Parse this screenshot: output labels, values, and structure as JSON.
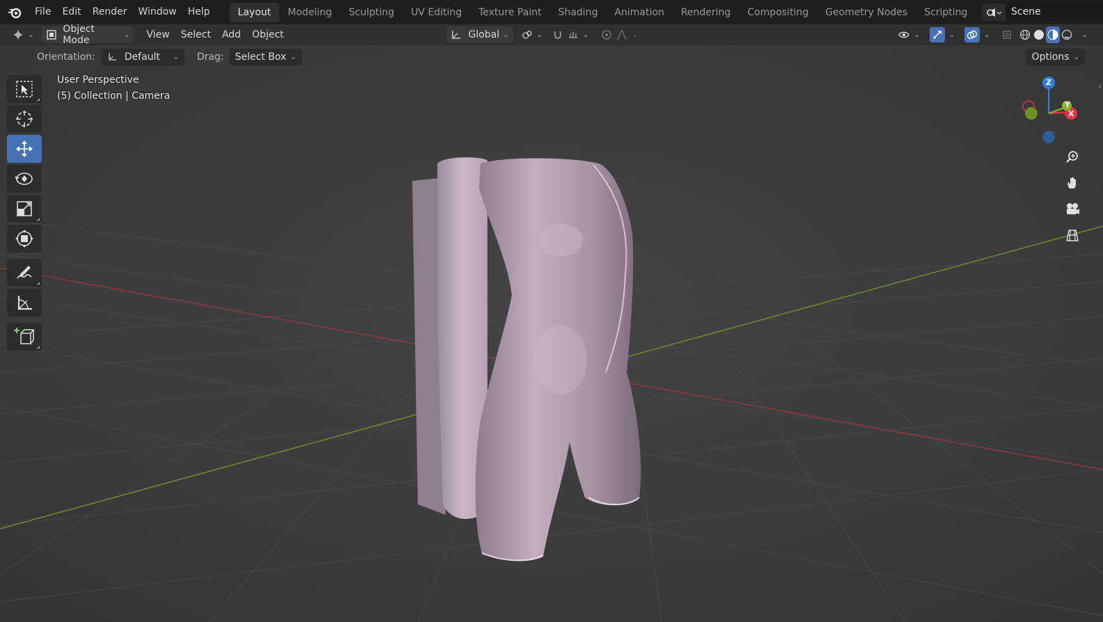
{
  "menu": {
    "items": [
      "File",
      "Edit",
      "Render",
      "Window",
      "Help"
    ]
  },
  "workspaces": {
    "tabs": [
      "Layout",
      "Modeling",
      "Sculpting",
      "UV Editing",
      "Texture Paint",
      "Shading",
      "Animation",
      "Rendering",
      "Compositing",
      "Geometry Nodes",
      "Scripting"
    ],
    "active": "Layout",
    "add_label": "+"
  },
  "scene": {
    "name": "Scene"
  },
  "header": {
    "mode_label": "Object Mode",
    "menus": [
      "View",
      "Select",
      "Add",
      "Object"
    ],
    "transform_orientation": "Global"
  },
  "tool_settings": {
    "orientation_label": "Orientation:",
    "orientation_value": "Default",
    "drag_label": "Drag:",
    "drag_value": "Select Box",
    "options_label": "Options"
  },
  "viewport": {
    "perspective_label": "User Perspective",
    "collection_label": "(5) Collection | Camera"
  },
  "gizmo": {
    "z_label": "Z",
    "y_label": "Y",
    "x_label": "X"
  },
  "colors": {
    "accent": "#4772b3",
    "background": "#3d3d3d",
    "x_axis": "#e0364a",
    "y_axis": "#8ab52b",
    "z_axis": "#2f7fd6",
    "mesh": "#b9a3b6"
  },
  "icons": {
    "tools": [
      "select-box-icon",
      "cursor-icon",
      "move-icon",
      "rotate-icon",
      "scale-icon",
      "transform-icon",
      "annotate-icon",
      "measure-icon",
      "add-cube-icon"
    ],
    "nav": [
      "zoom-icon",
      "pan-hand-icon",
      "camera-view-icon",
      "ortho-grid-icon"
    ]
  }
}
